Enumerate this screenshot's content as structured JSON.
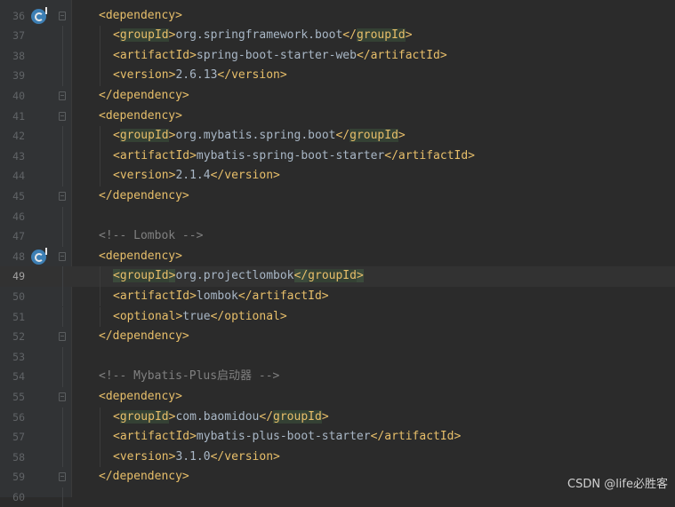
{
  "editor": {
    "lines": [
      {
        "num": "36",
        "indent": 0,
        "type": "open",
        "tag": "dependency",
        "icon": "spring-bean-gutter-icon",
        "fold": "start"
      },
      {
        "num": "37",
        "indent": 1,
        "type": "element",
        "tag": "groupId",
        "text": "org.springframework.boot",
        "highlight": true
      },
      {
        "num": "38",
        "indent": 1,
        "type": "element",
        "tag": "artifactId",
        "text": "spring-boot-starter-web"
      },
      {
        "num": "39",
        "indent": 1,
        "type": "element",
        "tag": "version",
        "text": "2.6.13"
      },
      {
        "num": "40",
        "indent": 0,
        "type": "close",
        "tag": "dependency",
        "fold": "end"
      },
      {
        "num": "41",
        "indent": 0,
        "type": "open",
        "tag": "dependency",
        "fold": "start"
      },
      {
        "num": "42",
        "indent": 1,
        "type": "element",
        "tag": "groupId",
        "text": "org.mybatis.spring.boot",
        "highlight": true
      },
      {
        "num": "43",
        "indent": 1,
        "type": "element",
        "tag": "artifactId",
        "text": "mybatis-spring-boot-starter"
      },
      {
        "num": "44",
        "indent": 1,
        "type": "element",
        "tag": "version",
        "text": "2.1.4"
      },
      {
        "num": "45",
        "indent": 0,
        "type": "close",
        "tag": "dependency",
        "fold": "end"
      },
      {
        "num": "46",
        "indent": 0,
        "type": "blank"
      },
      {
        "num": "47",
        "indent": 0,
        "type": "comment",
        "text": "<!-- Lombok -->"
      },
      {
        "num": "48",
        "indent": 0,
        "type": "open",
        "tag": "dependency",
        "icon": "spring-bean-gutter-icon",
        "fold": "start"
      },
      {
        "num": "49",
        "indent": 1,
        "type": "element",
        "tag": "groupId",
        "text": "org.projectlombok",
        "highlight": true,
        "current": true,
        "tag_match": true
      },
      {
        "num": "50",
        "indent": 1,
        "type": "element",
        "tag": "artifactId",
        "text": "lombok"
      },
      {
        "num": "51",
        "indent": 1,
        "type": "element",
        "tag": "optional",
        "text": "true"
      },
      {
        "num": "52",
        "indent": 0,
        "type": "close",
        "tag": "dependency",
        "fold": "end"
      },
      {
        "num": "53",
        "indent": 0,
        "type": "blank"
      },
      {
        "num": "54",
        "indent": 0,
        "type": "comment",
        "text": "<!-- Mybatis-Plus启动器 -->"
      },
      {
        "num": "55",
        "indent": 0,
        "type": "open",
        "tag": "dependency",
        "fold": "start"
      },
      {
        "num": "56",
        "indent": 1,
        "type": "element",
        "tag": "groupId",
        "text": "com.baomidou",
        "highlight": true
      },
      {
        "num": "57",
        "indent": 1,
        "type": "element",
        "tag": "artifactId",
        "text": "mybatis-plus-boot-starter"
      },
      {
        "num": "58",
        "indent": 1,
        "type": "element",
        "tag": "version",
        "text": "3.1.0"
      },
      {
        "num": "59",
        "indent": 0,
        "type": "close",
        "tag": "dependency",
        "fold": "end"
      },
      {
        "num": "60",
        "indent": 0,
        "type": "blank"
      }
    ]
  },
  "watermark": "CSDN @life必胜客",
  "colors": {
    "background": "#2b2b2b",
    "gutter": "#313335",
    "tag": "#e8bf6a",
    "text": "#a9b7c6",
    "comment": "#808080",
    "line_number": "#606366",
    "highlight": "#344134"
  }
}
